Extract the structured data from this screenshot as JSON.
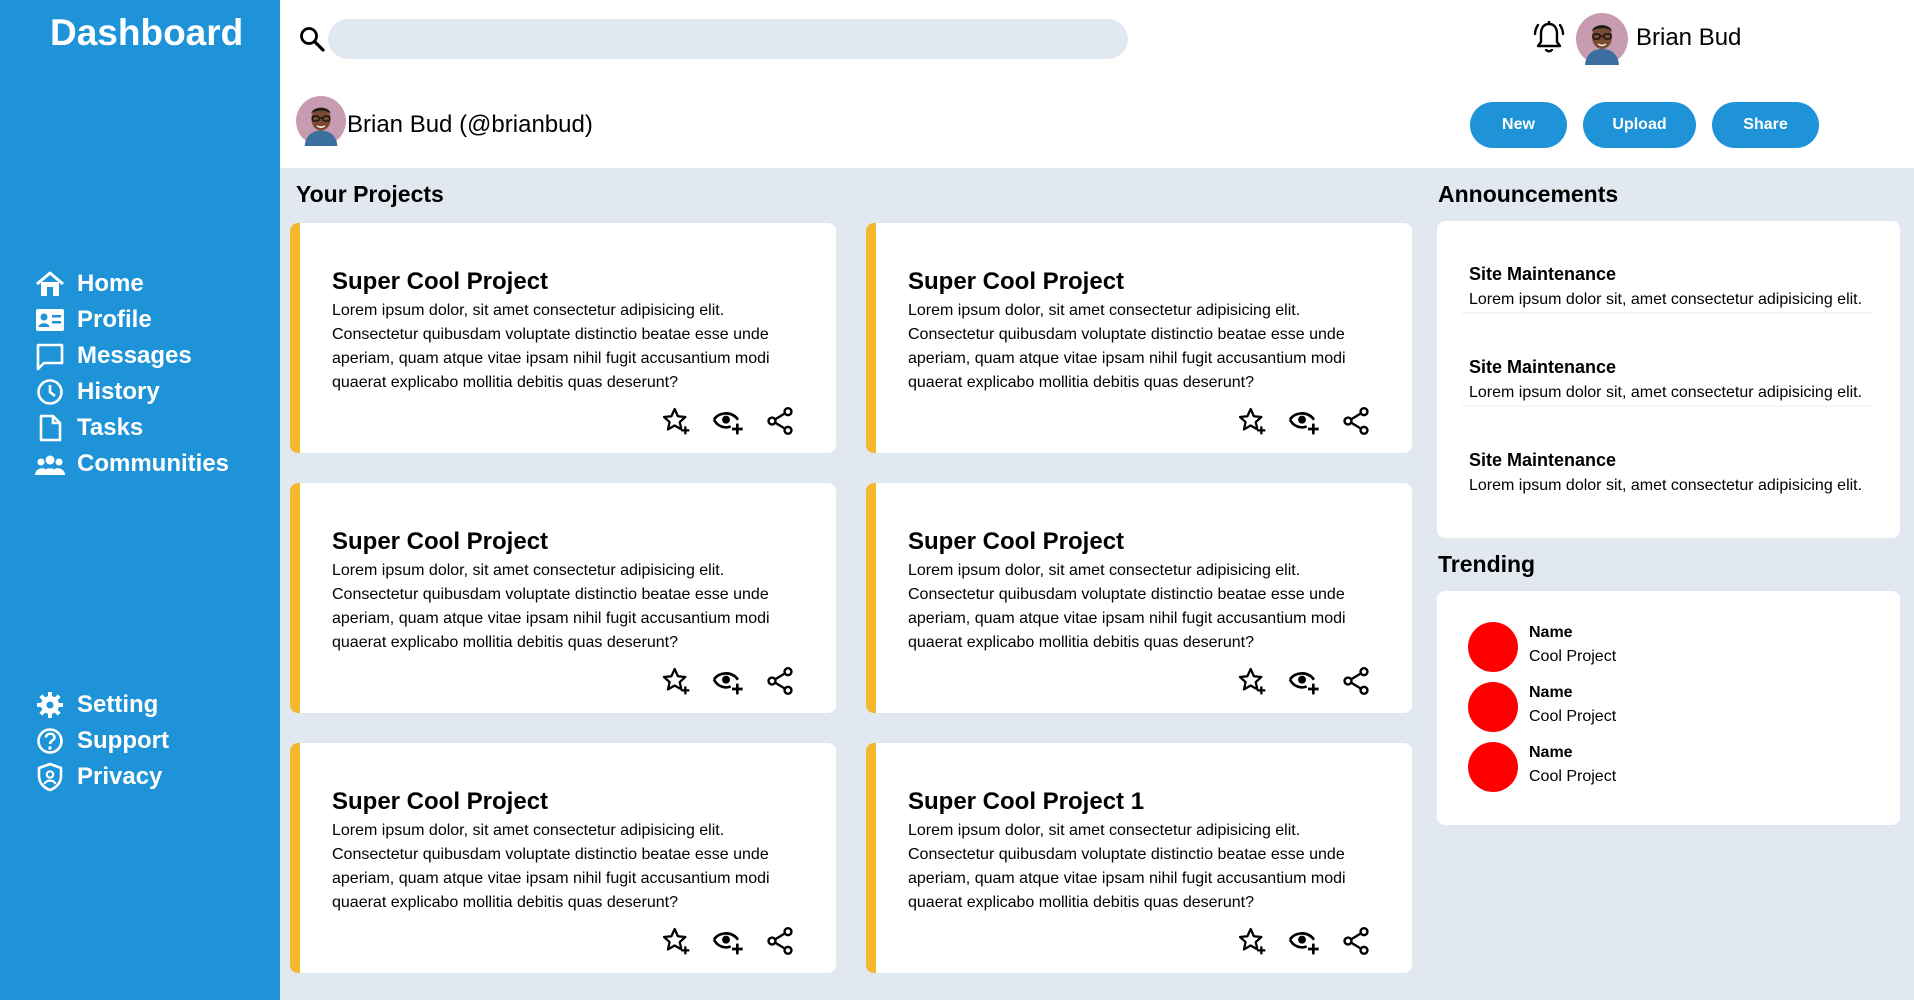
{
  "sidebar": {
    "brand": "Dashboard",
    "items": [
      {
        "label": "Home",
        "icon": "home-icon"
      },
      {
        "label": "Profile",
        "icon": "profile-card-icon"
      },
      {
        "label": "Messages",
        "icon": "message-icon"
      },
      {
        "label": "History",
        "icon": "clock-icon"
      },
      {
        "label": "Tasks",
        "icon": "document-icon"
      },
      {
        "label": "Communities",
        "icon": "people-icon"
      }
    ],
    "bottom_items": [
      {
        "label": "Setting",
        "icon": "gear-icon"
      },
      {
        "label": "Support",
        "icon": "help-circle-icon"
      },
      {
        "label": "Privacy",
        "icon": "shield-user-icon"
      }
    ]
  },
  "header": {
    "search_placeholder": "",
    "user_name": "Brian Bud",
    "profile_label": "Brian Bud (@brianbud)",
    "buttons": {
      "new": "New",
      "upload": "Upload",
      "share": "Share"
    }
  },
  "projects": {
    "title": "Your Projects",
    "cards": [
      {
        "title": "Super Cool Project",
        "desc": "Lorem ipsum dolor, sit amet consectetur adipisicing elit. Consectetur quibusdam voluptate distinctio beatae esse unde aperiam, quam atque vitae ipsam nihil fugit accusantium modi quaerat explicabo mollitia debitis quas deserunt?"
      },
      {
        "title": "Super Cool Project",
        "desc": "Lorem ipsum dolor, sit amet consectetur adipisicing elit. Consectetur quibusdam voluptate distinctio beatae esse unde aperiam, quam atque vitae ipsam nihil fugit accusantium modi quaerat explicabo mollitia debitis quas deserunt?"
      },
      {
        "title": "Super Cool Project",
        "desc": "Lorem ipsum dolor, sit amet consectetur adipisicing elit. Consectetur quibusdam voluptate distinctio beatae esse unde aperiam, quam atque vitae ipsam nihil fugit accusantium modi quaerat explicabo mollitia debitis quas deserunt?"
      },
      {
        "title": "Super Cool Project",
        "desc": "Lorem ipsum dolor, sit amet consectetur adipisicing elit. Consectetur quibusdam voluptate distinctio beatae esse unde aperiam, quam atque vitae ipsam nihil fugit accusantium modi quaerat explicabo mollitia debitis quas deserunt?"
      },
      {
        "title": "Super Cool Project",
        "desc": "Lorem ipsum dolor, sit amet consectetur adipisicing elit. Consectetur quibusdam voluptate distinctio beatae esse unde aperiam, quam atque vitae ipsam nihil fugit accusantium modi quaerat explicabo mollitia debitis quas deserunt?"
      },
      {
        "title": "Super Cool Project 1",
        "desc": "Lorem ipsum dolor, sit amet consectetur adipisicing elit. Consectetur quibusdam voluptate distinctio beatae esse unde aperiam, quam atque vitae ipsam nihil fugit accusantium modi quaerat explicabo mollitia debitis quas deserunt?"
      }
    ],
    "card_action_icons": [
      "star-plus-icon",
      "eye-plus-icon",
      "share-icon"
    ]
  },
  "announcements": {
    "title": "Announcements",
    "items": [
      {
        "title": "Site Maintenance",
        "desc": "Lorem ipsum dolor sit, amet consectetur adipisicing elit."
      },
      {
        "title": "Site Maintenance",
        "desc": "Lorem ipsum dolor sit, amet consectetur adipisicing elit."
      },
      {
        "title": "Site Maintenance",
        "desc": "Lorem ipsum dolor sit, amet consectetur adipisicing elit."
      }
    ]
  },
  "trending": {
    "title": "Trending",
    "items": [
      {
        "name": "Name",
        "project": "Cool Project"
      },
      {
        "name": "Name",
        "project": "Cool Project"
      },
      {
        "name": "Name",
        "project": "Cool Project"
      }
    ]
  },
  "colors": {
    "primary": "#1f93d8",
    "accent": "#f3b82d",
    "background": "#e2e8f0",
    "trend_dot": "#ff0000"
  }
}
